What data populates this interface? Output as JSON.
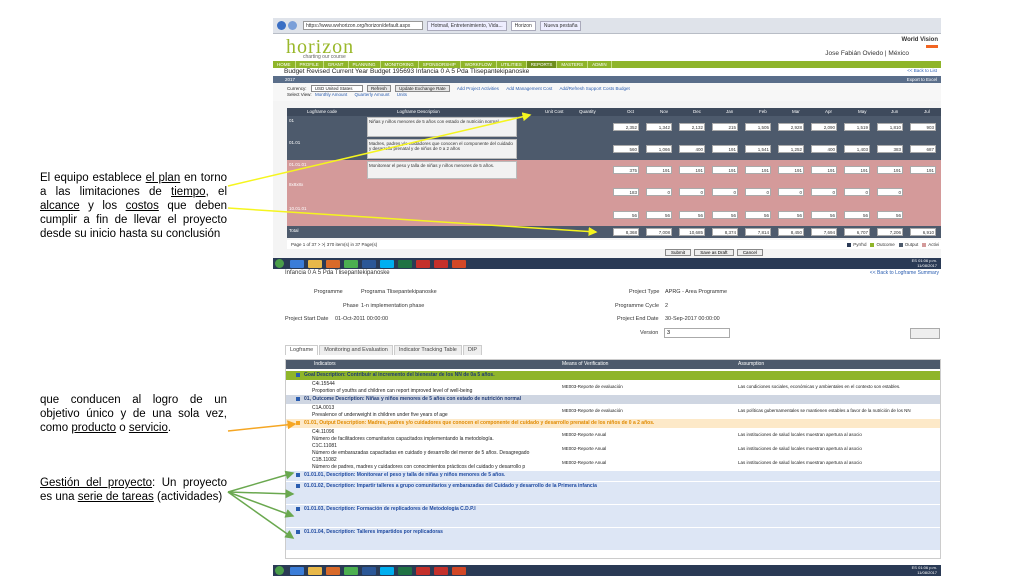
{
  "annotations": {
    "a1": {
      "pre": "E",
      "u1": "l equipo establece ",
      "u2": "el plan",
      "p3": " en torno a las limitaciones de ",
      "u4": "tiempo",
      "p5": ", el ",
      "u6": "alcance",
      "p7": " y los ",
      "u8": "costos",
      "p9": " que deben cumplir a fin de llevar el proyecto desde su inicio hasta su conclusión"
    },
    "a2": {
      "p1": "que conducen al logro de un objetivo único y de una sola vez, como ",
      "u2": "producto",
      "p3": " o ",
      "u4": "servicio",
      "p5": "."
    },
    "a3": {
      "u1": "Gestión del proyecto",
      "p2": ": Un proyecto es una ",
      "u3": "serie de tareas",
      "p4": " (actividades)"
    }
  },
  "screen1": {
    "browser": {
      "address": "https://www.wvhorizon.org/horizon/default.aspx",
      "tab1": "Hotmail, Entretenimiento, Vida...",
      "tab2": "Horizon",
      "tab3": "Nueva pestaña"
    },
    "logo": "horizon",
    "tagline": "charting our course",
    "org": "World Vision",
    "user": "Jose Fabián Oviedo",
    "user_country": "México",
    "menu": [
      "HOME",
      "PROFILE",
      "GRANT",
      "PLANNING",
      "MONITORING",
      "SPONSORSHIP",
      "WORKFLOW",
      "UTILITIES",
      "REPORTS",
      "MASTERS",
      "ADMIN"
    ],
    "budget_title": "Budget   Revised Current Year Budget 195693 Infancia 0 A 5 Pda Tlisepantekipanoske",
    "back_link": "<< Back to List",
    "year": "2017",
    "export": "Export to Excel",
    "currency_label": "Currency:",
    "currency_value": "USD  United States",
    "refresh": "Refresh",
    "update_rate": "Update Exchange Rate",
    "add_activity": "Add Project Activities",
    "add_cost": "Add Management Cost",
    "add_support": "Add/Refresh Support Costs Budget",
    "select_view": "Select View:",
    "view1": "Monthly Amount",
    "view2": "Quarterly Amount",
    "view3": "Units",
    "col_code": "Logframe code",
    "col_desc": "Logframe Description",
    "col_unit": "Unit Cost",
    "col_qty": "Quantity",
    "months": [
      "Oct",
      "Nov",
      "Dec",
      "Jan",
      "Feb",
      "Mar",
      "Apr",
      "May",
      "Jun",
      "Jul"
    ],
    "rows": [
      {
        "code": "01",
        "desc": "Niñas y niños menores de 5 años con estado de nutrición normal",
        "vals": [
          "2,352",
          "1,342",
          "2,132",
          "215",
          "1,505",
          "2,928",
          "2,090",
          "1,519",
          "1,810",
          "903"
        ]
      },
      {
        "code": "01.01",
        "desc": "Madres, padres y/o cuidadores que conocen el componente del cuidado y desarrollo prenatal y de niños de 0 a 2 años",
        "vals": [
          "560",
          "1,066",
          "400",
          "191",
          "1,541",
          "1,252",
          "400",
          "1,403",
          "383",
          "687"
        ]
      },
      {
        "code": "01.01.01",
        "desc": "Monitorear el peso y talla de niñas y niños menores de 5 años.",
        "vals": [
          "375",
          "191",
          "191",
          "191",
          "191",
          "191",
          "191",
          "191",
          "191",
          "191"
        ]
      },
      {
        "code": "8x8x8x",
        "desc": "",
        "vals": [
          "183",
          "0",
          "0",
          "0",
          "0",
          "0",
          "0",
          "0",
          "0",
          ""
        ]
      },
      {
        "code": "10.01.01",
        "desc": "",
        "vals": [
          "56",
          "56",
          "56",
          "56",
          "56",
          "56",
          "56",
          "56",
          "56",
          ""
        ]
      }
    ],
    "total_label": "Total",
    "totals": [
      "8,368",
      "7,008",
      "10,685",
      "8,374",
      "7,814",
      "8,450",
      "7,694",
      "6,707",
      "7,206",
      "6,910"
    ],
    "pager": "Page 1 of 37  >  >|  370 item(s) in 37 Page(s)",
    "legend": [
      "Pyrrhd",
      "Outcome",
      "Output",
      "Activi"
    ],
    "submit": "Submit",
    "draft": "Save as Draft",
    "cancel": "Cancel",
    "clock": "01:06 p.m.",
    "date": "11/08/2017",
    "lang": "ES"
  },
  "screen2": {
    "title": "Infancia 0 A 5 Pda Tlisepantekipanoske",
    "back": "<< Back to Logframe Summary",
    "programme_label": "Programme",
    "programme": "Programa Tlisepantekipanoske",
    "phase_label": "Phase",
    "phase": "1-n implementation phase",
    "start_label": "Project Start Date",
    "start": "01-Oct-2011 00:00:00",
    "type_label": "Project Type",
    "type": "APRG - Area Programme",
    "cycle_label": "Programme Cycle",
    "cycle": "2",
    "end_label": "Project End Date",
    "end": "30-Sep-2017 00:00:00",
    "version_label": "Version",
    "version": "3",
    "tabs": [
      "Logframe",
      "Monitoring and Evaluation",
      "Indicator Tracking Table",
      "DIP"
    ],
    "col_ind": "Indicators",
    "col_mov": "Means of Verification",
    "col_ass": "Assumption",
    "rows": [
      {
        "kind": "goal",
        "text": "Goal Description: Contribuir al incremento del bienestar de los NN de 0a 5 años.",
        "color": "#8fb52a"
      },
      {
        "kind": "data",
        "text": "C4i.15544",
        "text2": "Proportion of youths and children can report improved level of well-being",
        "mov": "ME003-Reporte de evaluación",
        "ass": "Las condiciones sociales, económicas y ambientales en el contexto son estables."
      },
      {
        "kind": "outcome",
        "text": "01, Outcome Description: Niñas y niños menores de 5 años con estado de nutrición normal",
        "color": "#cfd6e2"
      },
      {
        "kind": "data",
        "text": "C1A.0013",
        "text2": "Prevalence of underweight in children under five years of age",
        "mov": "ME003-Reporte de evaluación",
        "ass": "Las políticas gubernamentales se mantienen estables a favor de la nutrición de los NN"
      },
      {
        "kind": "output",
        "text": "01.01, Output Description: Madres, padres y/o cuidadores  que conocen el componente  del cuidado y desarrollo prenatal de los niños de 0 a 2  años.",
        "color": "#fde9c8"
      },
      {
        "kind": "data",
        "text": "C4i.11096",
        "text2": "Número de facilitadores comunitarios capacitados implementando la metodología.",
        "mov": "ME002-Reporte Anual",
        "ass": "Las instituciones de salud locales muestran apertura al asocio"
      },
      {
        "kind": "data",
        "text": "C1C.11081",
        "text2": "Número de embarazadas capacitadas en cuidado y desarrollo del menor de 5 años. Desagregado",
        "mov": "ME002-Reporte Anual",
        "ass": "Las instituciones de salud locales muestran apertura al asocio"
      },
      {
        "kind": "data",
        "text": "C1B.11082",
        "text2": "Número de padres, madres y cuidadores con conocimientos prácticos  del cuidado y desarrollo p",
        "mov": "ME002-Reporte Anual",
        "ass": "Las instituciones de salud locales muestran apertura al asocio"
      },
      {
        "kind": "activity",
        "text": "01.01.01, Description: Monitorear el peso y talla de niñas y niños menores de 5 años.",
        "color": "#dde6f5"
      },
      {
        "kind": "activity",
        "text": "01.01.02, Description: Impartir talleres  a  grupo comunitarios  y embarazadas del Cuidado y desarrollo de la Primera infancia",
        "color": "#dde6f5"
      },
      {
        "kind": "activity",
        "text": "01.01.03, Description: Formación de replicadores  de Metodología C.D.P.I",
        "color": "#dde6f5"
      },
      {
        "kind": "activity",
        "text": "01.01.04, Description: Talleres impartidos por replicadoras",
        "color": "#dde6f5"
      }
    ],
    "clock": "01:06 p.m.",
    "date": "11/08/2017",
    "lang": "ES"
  }
}
